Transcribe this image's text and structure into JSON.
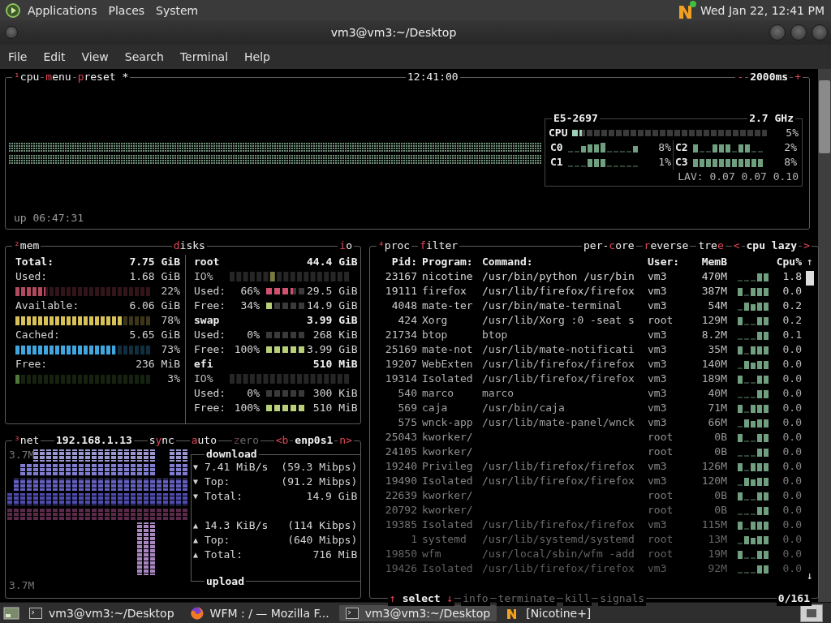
{
  "top_panel": {
    "menus": [
      "Applications",
      "Places",
      "System"
    ],
    "clock": "Wed Jan 22, 12:41 PM"
  },
  "window": {
    "title": "vm3@vm3:~/Desktop"
  },
  "menubar": [
    "File",
    "Edit",
    "View",
    "Search",
    "Terminal",
    "Help"
  ],
  "cpu": {
    "title": [
      {
        "key": "¹",
        "rest": "cpu"
      },
      {
        "key": "m",
        "rest": "enu"
      },
      {
        "key": "p",
        "rest": "reset *"
      }
    ],
    "time": "12:41:00",
    "interval": {
      "minus": "-",
      "value": "2000ms",
      "plus": "+"
    },
    "uptime": "up 06:47:31",
    "model": "E5-2697",
    "freq": "2.7 GHz",
    "total": {
      "label": "CPU",
      "percent": "5%",
      "level": 0.05
    },
    "cores": [
      {
        "name": "C0",
        "percent": "8%"
      },
      {
        "name": "C2",
        "percent": "2%"
      },
      {
        "name": "C1",
        "percent": "1%"
      },
      {
        "name": "C3",
        "percent": "8%"
      }
    ],
    "load": "LAV: 0.07 0.07 0.10"
  },
  "mem": {
    "title": {
      "key": "²",
      "rest": "mem"
    },
    "rows": [
      {
        "kind": "total",
        "label": "Total:",
        "value": "7.75 GiB"
      },
      {
        "kind": "meter",
        "label": "Used:",
        "value": "1.68 GiB",
        "percent": "22%",
        "level": 0.22,
        "color": "#b04a5e"
      },
      {
        "kind": "meter",
        "label": "Available:",
        "value": "6.06 GiB",
        "percent": "78%",
        "level": 0.78,
        "color": "#d8c258"
      },
      {
        "kind": "meter",
        "label": "Cached:",
        "value": "5.65 GiB",
        "percent": "73%",
        "level": 0.73,
        "color": "#3fa6df"
      },
      {
        "kind": "meter",
        "label": "Free:",
        "value": "236 MiB",
        "percent": "3%",
        "level": 0.03,
        "color": "#4f7a3a"
      }
    ]
  },
  "disks": {
    "title": {
      "key": "d",
      "rest": "isks"
    },
    "io_toggle": {
      "key": "i",
      "rest": "o"
    },
    "items": [
      {
        "name": "root",
        "size": "44.4 GiB",
        "io_label": "IO%",
        "used": {
          "label": "Used:",
          "percent": "66%",
          "value": "29.5 GiB",
          "level": 0.66
        },
        "free": {
          "label": "Free:",
          "percent": "34%",
          "value": "14.9 GiB",
          "level": 0.2
        }
      },
      {
        "name": "swap",
        "size": "3.99 GiB",
        "used": {
          "label": "Used:",
          "percent": "0%",
          "value": "268 KiB",
          "level": 0
        },
        "free": {
          "label": "Free:",
          "percent": "100%",
          "value": "3.99 GiB",
          "level": 1
        }
      },
      {
        "name": "efi",
        "size": "510 MiB",
        "io_label": "IO%",
        "used": {
          "label": "Used:",
          "percent": "0%",
          "value": "300 KiB",
          "level": 0
        },
        "free": {
          "label": "Free:",
          "percent": "100%",
          "value": "510 MiB",
          "level": 1
        }
      }
    ]
  },
  "net": {
    "title": {
      "key": "³",
      "rest": "net"
    },
    "ip": "192.168.1.13",
    "toggles": [
      {
        "pre": "s",
        "key": "y",
        "rest": "nc",
        "on": true
      },
      {
        "key": "a",
        "rest": "uto",
        "on": true
      },
      {
        "key": "z",
        "rest": "ero",
        "on": false
      }
    ],
    "interface": {
      "prev": "<b",
      "name": "enp0s1",
      "next": "n>"
    },
    "scale_top": "3.7M",
    "scale_bottom": "3.7M",
    "download": {
      "title": "download",
      "rows": [
        {
          "arrow": "▼",
          "label": "7.41 MiB/s",
          "value": "(59.3 Mibps)"
        },
        {
          "arrow": "▼",
          "label": "Top:",
          "value": "(91.2 Mibps)"
        },
        {
          "arrow": "▼",
          "label": "Total:",
          "value": "14.9 GiB"
        }
      ]
    },
    "upload": {
      "title": "upload",
      "rows": [
        {
          "arrow": "▲",
          "label": "14.3 KiB/s",
          "value": "(114 Kibps)"
        },
        {
          "arrow": "▲",
          "label": "Top:",
          "value": "(640 Mibps)"
        },
        {
          "arrow": "▲",
          "label": "Total:",
          "value": "716 MiB"
        }
      ]
    }
  },
  "proc": {
    "title": {
      "key": "⁴",
      "rest": "proc"
    },
    "filter": {
      "key": "f",
      "rest": "ilter"
    },
    "options": [
      {
        "pre": "per-",
        "key": "c",
        "rest": "ore"
      },
      {
        "key": "r",
        "rest": "everse"
      },
      {
        "pre": "tre",
        "key": "e"
      }
    ],
    "sort": {
      "prev": "<",
      "name": "cpu lazy",
      "next": ">"
    },
    "columns": [
      "Pid:",
      "Program:",
      "Command:",
      "User:",
      "MemB",
      "Cpu%"
    ],
    "scroll_up": "↑",
    "scroll_down": "↓",
    "rows": [
      {
        "pid": "23167",
        "program": "nicotine",
        "command": "/usr/bin/python /usr/bin",
        "user": "vm3",
        "mem": "470M",
        "cpu": "1.8"
      },
      {
        "pid": "19111",
        "program": "firefox",
        "command": "/usr/lib/firefox/firefox",
        "user": "vm3",
        "mem": "387M",
        "cpu": "0.0"
      },
      {
        "pid": "4048",
        "program": "mate-ter",
        "command": "/usr/bin/mate-terminal",
        "user": "vm3",
        "mem": "54M",
        "cpu": "0.2"
      },
      {
        "pid": "424",
        "program": "Xorg",
        "command": "/usr/lib/Xorg :0 -seat s",
        "user": "root",
        "mem": "129M",
        "cpu": "0.2"
      },
      {
        "pid": "21734",
        "program": "btop",
        "command": "btop",
        "user": "vm3",
        "mem": "8.2M",
        "cpu": "0.1"
      },
      {
        "pid": "25169",
        "program": "mate-not",
        "command": "/usr/lib/mate-notificati",
        "user": "vm3",
        "mem": "35M",
        "cpu": "0.0"
      },
      {
        "pid": "19207",
        "program": "WebExten",
        "command": "/usr/lib/firefox/firefox",
        "user": "vm3",
        "mem": "140M",
        "cpu": "0.0"
      },
      {
        "pid": "19314",
        "program": "Isolated",
        "command": "/usr/lib/firefox/firefox",
        "user": "vm3",
        "mem": "189M",
        "cpu": "0.0"
      },
      {
        "pid": "540",
        "program": "marco",
        "command": "marco",
        "user": "vm3",
        "mem": "40M",
        "cpu": "0.0"
      },
      {
        "pid": "569",
        "program": "caja",
        "command": "/usr/bin/caja",
        "user": "vm3",
        "mem": "71M",
        "cpu": "0.0"
      },
      {
        "pid": "575",
        "program": "wnck-app",
        "command": "/usr/lib/mate-panel/wnck",
        "user": "vm3",
        "mem": "66M",
        "cpu": "0.0"
      },
      {
        "pid": "25043",
        "program": "kworker/",
        "user": "root",
        "mem": "0B",
        "cpu": "0.0"
      },
      {
        "pid": "24105",
        "program": "kworker/",
        "user": "root",
        "mem": "0B",
        "cpu": "0.0"
      },
      {
        "pid": "19240",
        "program": "Privileg",
        "command": "/usr/lib/firefox/firefox",
        "user": "vm3",
        "mem": "126M",
        "cpu": "0.0"
      },
      {
        "pid": "19490",
        "program": "Isolated",
        "command": "/usr/lib/firefox/firefox",
        "user": "vm3",
        "mem": "120M",
        "cpu": "0.0"
      },
      {
        "pid": "22639",
        "program": "kworker/",
        "user": "root",
        "mem": "0B",
        "cpu": "0.0"
      },
      {
        "pid": "20792",
        "program": "kworker/",
        "user": "root",
        "mem": "0B",
        "cpu": "0.0"
      },
      {
        "pid": "19385",
        "program": "Isolated",
        "command": "/usr/lib/firefox/firefox",
        "user": "vm3",
        "mem": "115M",
        "cpu": "0.0"
      },
      {
        "pid": "1",
        "program": "systemd",
        "command": "/usr/lib/systemd/systemd",
        "user": "root",
        "mem": "13M",
        "cpu": "0.0"
      },
      {
        "pid": "19850",
        "program": "wfm",
        "command": "/usr/local/sbin/wfm -add",
        "user": "root",
        "mem": "19M",
        "cpu": "0.0"
      },
      {
        "pid": "19426",
        "program": "Isolated",
        "command": "/usr/lib/firefox/firefox",
        "user": "vm3",
        "mem": "92M",
        "cpu": "0.0"
      }
    ],
    "footer": {
      "select": {
        "up": "↑",
        "label": "select",
        "down": "↓"
      },
      "actions": [
        {
          "label": "info",
          "disabled": true
        },
        {
          "label": "terminate",
          "disabled": true
        },
        {
          "label": "kill",
          "disabled": true
        },
        {
          "label": "signals",
          "disabled": true
        }
      ],
      "count": "0/161"
    }
  },
  "taskbar": [
    {
      "kind": "terminal",
      "label": "vm3@vm3:~/Desktop",
      "selected": false
    },
    {
      "kind": "browser",
      "label": "WFM : / — Mozilla F...",
      "selected": false
    },
    {
      "kind": "terminal",
      "label": "vm3@vm3:~/Desktop",
      "selected": true
    },
    {
      "kind": "nicotine",
      "label": "[Nicotine+]",
      "selected": false
    }
  ]
}
